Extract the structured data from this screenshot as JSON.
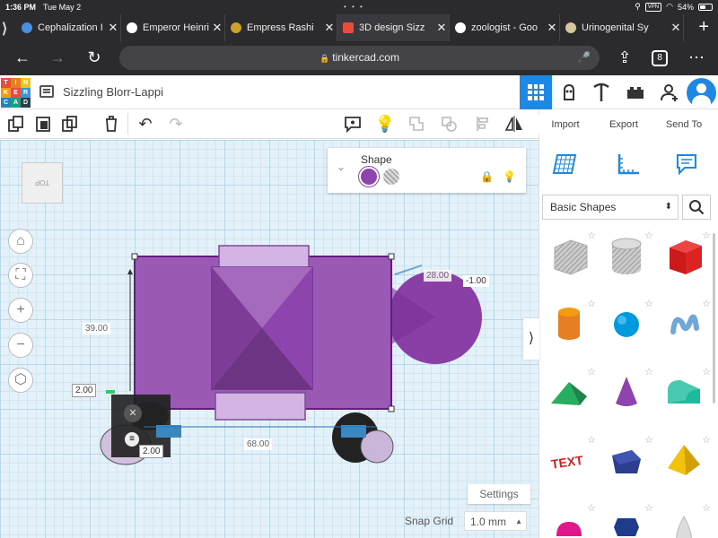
{
  "status_bar": {
    "time": "1:36 PM",
    "date": "Tue May 2",
    "vpn": "VPN",
    "battery": "54%",
    "battery_level": 0.54
  },
  "browser": {
    "tabs": [
      {
        "title": "Cephalization I",
        "favicon_color": "#4a90e2"
      },
      {
        "title": "Emperor Heinri",
        "favicon_color": "#ffffff"
      },
      {
        "title": "Empress Rashi",
        "favicon_color": "#c9a227"
      },
      {
        "title": "3D design Sizz",
        "favicon_color": "#e74c3c"
      },
      {
        "title": "zoologist - Goo",
        "favicon_color": "#ffffff"
      },
      {
        "title": "Urinogenital Sy",
        "favicon_color": "#d8c8a0"
      }
    ],
    "active_tab": 3,
    "url": "tinkercad.com",
    "tab_count": "8"
  },
  "header": {
    "logo_letters": [
      "TIN",
      "KER",
      "CAD"
    ],
    "design_name": "Sizzling Blorr-Lappi",
    "accent_color": "#1e88e5"
  },
  "toolbar": {
    "import_label": "Import",
    "export_label": "Export",
    "send_to_label": "Send To"
  },
  "workplane": {
    "view_cube_label": "TOP",
    "dimensions": {
      "height": "39.00",
      "width_top": "28.00",
      "elevation": "-1.00",
      "length": "68.00",
      "small_left": "2.00",
      "small_bottom": "2.00"
    },
    "settings_label": "Settings",
    "snap_grid_label": "Snap Grid",
    "snap_grid_value": "1.0 mm"
  },
  "shape_panel": {
    "title": "Shape",
    "solid_color": "#8e44ad"
  },
  "library": {
    "category": "Basic Shapes",
    "shapes": [
      "box-hole",
      "cylinder-hole",
      "box",
      "cylinder",
      "sphere",
      "scribble",
      "roof",
      "cone",
      "round-roof",
      "text",
      "polygon",
      "pyramid",
      "half-sphere",
      "hexagonal-prism",
      "paraboloid"
    ]
  }
}
